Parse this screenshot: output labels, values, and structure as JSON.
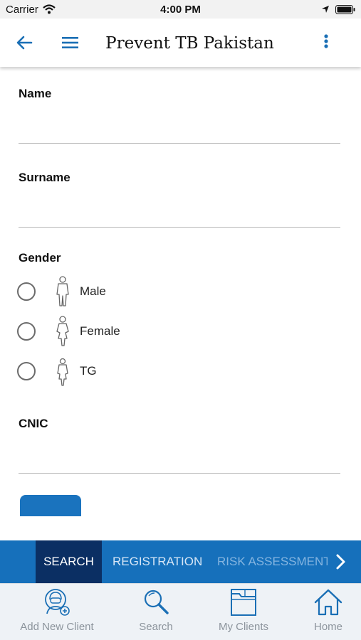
{
  "status": {
    "carrier": "Carrier",
    "time": "4:00 PM"
  },
  "header": {
    "title": "Prevent TB Pakistan"
  },
  "form": {
    "name_label": "Name",
    "name_value": "",
    "surname_label": "Surname",
    "surname_value": "",
    "gender_label": "Gender",
    "gender_options": [
      "Male",
      "Female",
      "TG"
    ],
    "cnic_label": "CNIC",
    "cnic_value": ""
  },
  "tabs": {
    "items": [
      "SEARCH",
      "REGISTRATION",
      "RISK ASSESSMENT A"
    ],
    "active": "SEARCH"
  },
  "bottom_nav": {
    "items": [
      "Add New Client",
      "Search",
      "My Clients",
      "Home"
    ]
  },
  "colors": {
    "accent": "#1670bb",
    "active_tab": "#0b2f63",
    "icon_blue": "#1a6fb5",
    "nav_text": "#8c949c"
  },
  "icons": {
    "back": "arrow-left-icon",
    "menu": "hamburger-icon",
    "more": "kebab-icon",
    "next": "chevron-right-icon"
  }
}
